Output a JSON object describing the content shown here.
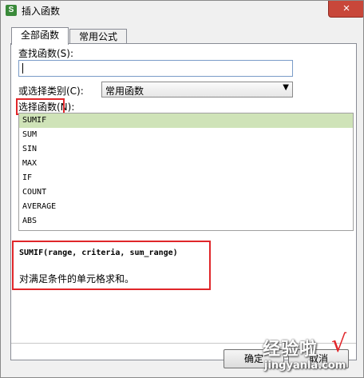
{
  "window": {
    "title": "插入函数",
    "app_icon": "S",
    "close_glyph": "×"
  },
  "tabs": [
    {
      "label": "全部函数",
      "active": true
    },
    {
      "label": "常用公式",
      "active": false
    }
  ],
  "search": {
    "label": "查找函数(S):",
    "value": ""
  },
  "category": {
    "label": "或选择类别(C):",
    "selected": "常用函数"
  },
  "function_list": {
    "label": "选择函数(N):",
    "items": [
      "SUMIF",
      "SUM",
      "SIN",
      "MAX",
      "IF",
      "COUNT",
      "AVERAGE",
      "ABS"
    ],
    "selected_index": 0
  },
  "description": {
    "syntax": "SUMIF(range, criteria, sum_range)",
    "text": "对满足条件的单元格求和。"
  },
  "buttons": {
    "ok": "确定",
    "cancel": "取消"
  },
  "watermark": {
    "main": "经验啦",
    "check": "√",
    "sub": "jingyanla.com"
  },
  "colors": {
    "highlight_border": "#e0262a",
    "selected_row": "#cfe3b8",
    "close_button": "#c8473a"
  }
}
